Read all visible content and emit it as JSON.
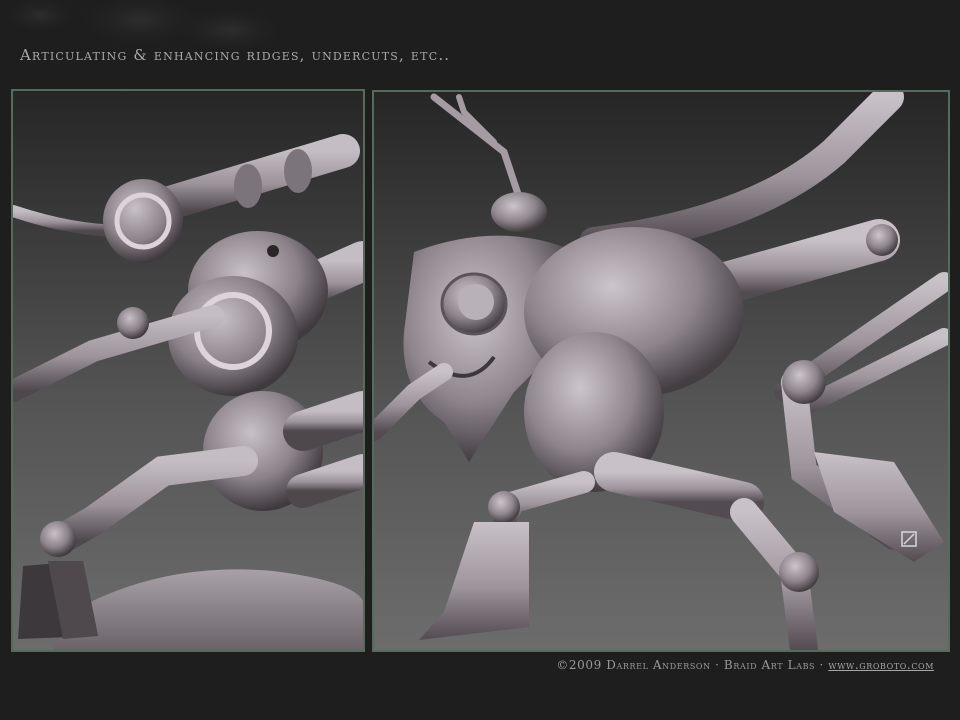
{
  "title": "Articulating & enhancing ridges, undercuts, etc..",
  "footer": {
    "credit": "©2009 Darrel Anderson · Braid Art Labs · ",
    "link": "www.groboto.com"
  },
  "colors": {
    "background": "#1e1e1e",
    "panel_border": "#566b5c",
    "model": "#a39ba2",
    "text": "#a9a9a9"
  }
}
